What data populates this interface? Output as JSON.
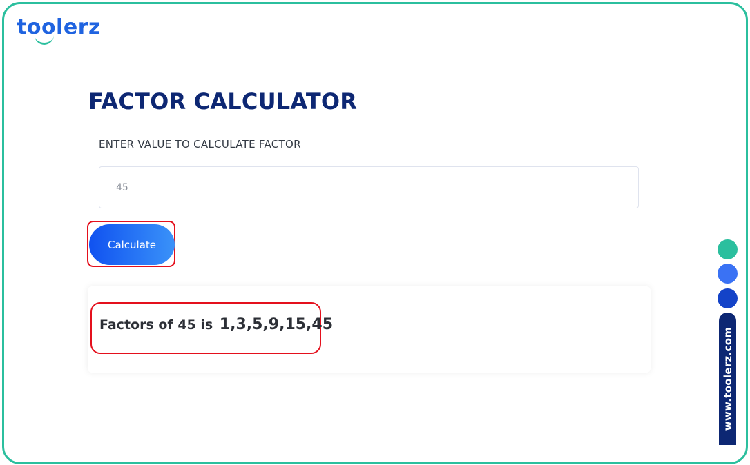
{
  "brand": {
    "logo_text": "toolerz",
    "side_url": "www.toolerz.com",
    "colors": {
      "teal": "#2bbf9e",
      "blue": "#1f63e0",
      "navy": "#0d2773",
      "highlight_red": "#e4101d"
    }
  },
  "page": {
    "title": "FACTOR CALCULATOR"
  },
  "form": {
    "input_label": "ENTER VALUE TO CALCULATE FACTOR",
    "input_value": "45",
    "button_label": "Calculate"
  },
  "result": {
    "prefix": "Factors of 45 is",
    "values": "1,3,5,9,15,45"
  },
  "decorations": {
    "dots": [
      "#2bbf9e",
      "#3a72f4",
      "#1443c8"
    ]
  }
}
